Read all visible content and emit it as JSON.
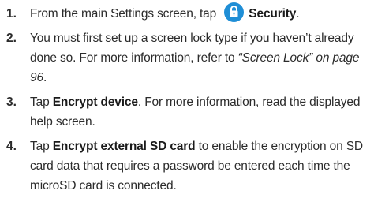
{
  "steps": [
    {
      "number": "1.",
      "parts": [
        {
          "t": "text",
          "v": "From the main Settings screen, tap "
        },
        {
          "t": "icon",
          "name": "security-lock-icon",
          "color": "#1f8ed6"
        },
        {
          "t": "bold",
          "v": "Security"
        },
        {
          "t": "text",
          "v": "."
        }
      ]
    },
    {
      "number": "2.",
      "parts": [
        {
          "t": "text",
          "v": "You must first set up a screen lock type if you haven’t already done so. For more information, refer to "
        },
        {
          "t": "italic",
          "v": "“Screen Lock”  on page 96"
        },
        {
          "t": "text",
          "v": "."
        }
      ]
    },
    {
      "number": "3.",
      "parts": [
        {
          "t": "text",
          "v": "Tap "
        },
        {
          "t": "bold",
          "v": "Encrypt device"
        },
        {
          "t": "text",
          "v": ". For more information, read the displayed help screen."
        }
      ]
    },
    {
      "number": "4.",
      "parts": [
        {
          "t": "text",
          "v": "Tap "
        },
        {
          "t": "bold",
          "v": "Encrypt external SD card"
        },
        {
          "t": "text",
          "v": " to enable the encryption on SD card data that requires a password be entered each time the microSD card is connected."
        }
      ]
    }
  ]
}
